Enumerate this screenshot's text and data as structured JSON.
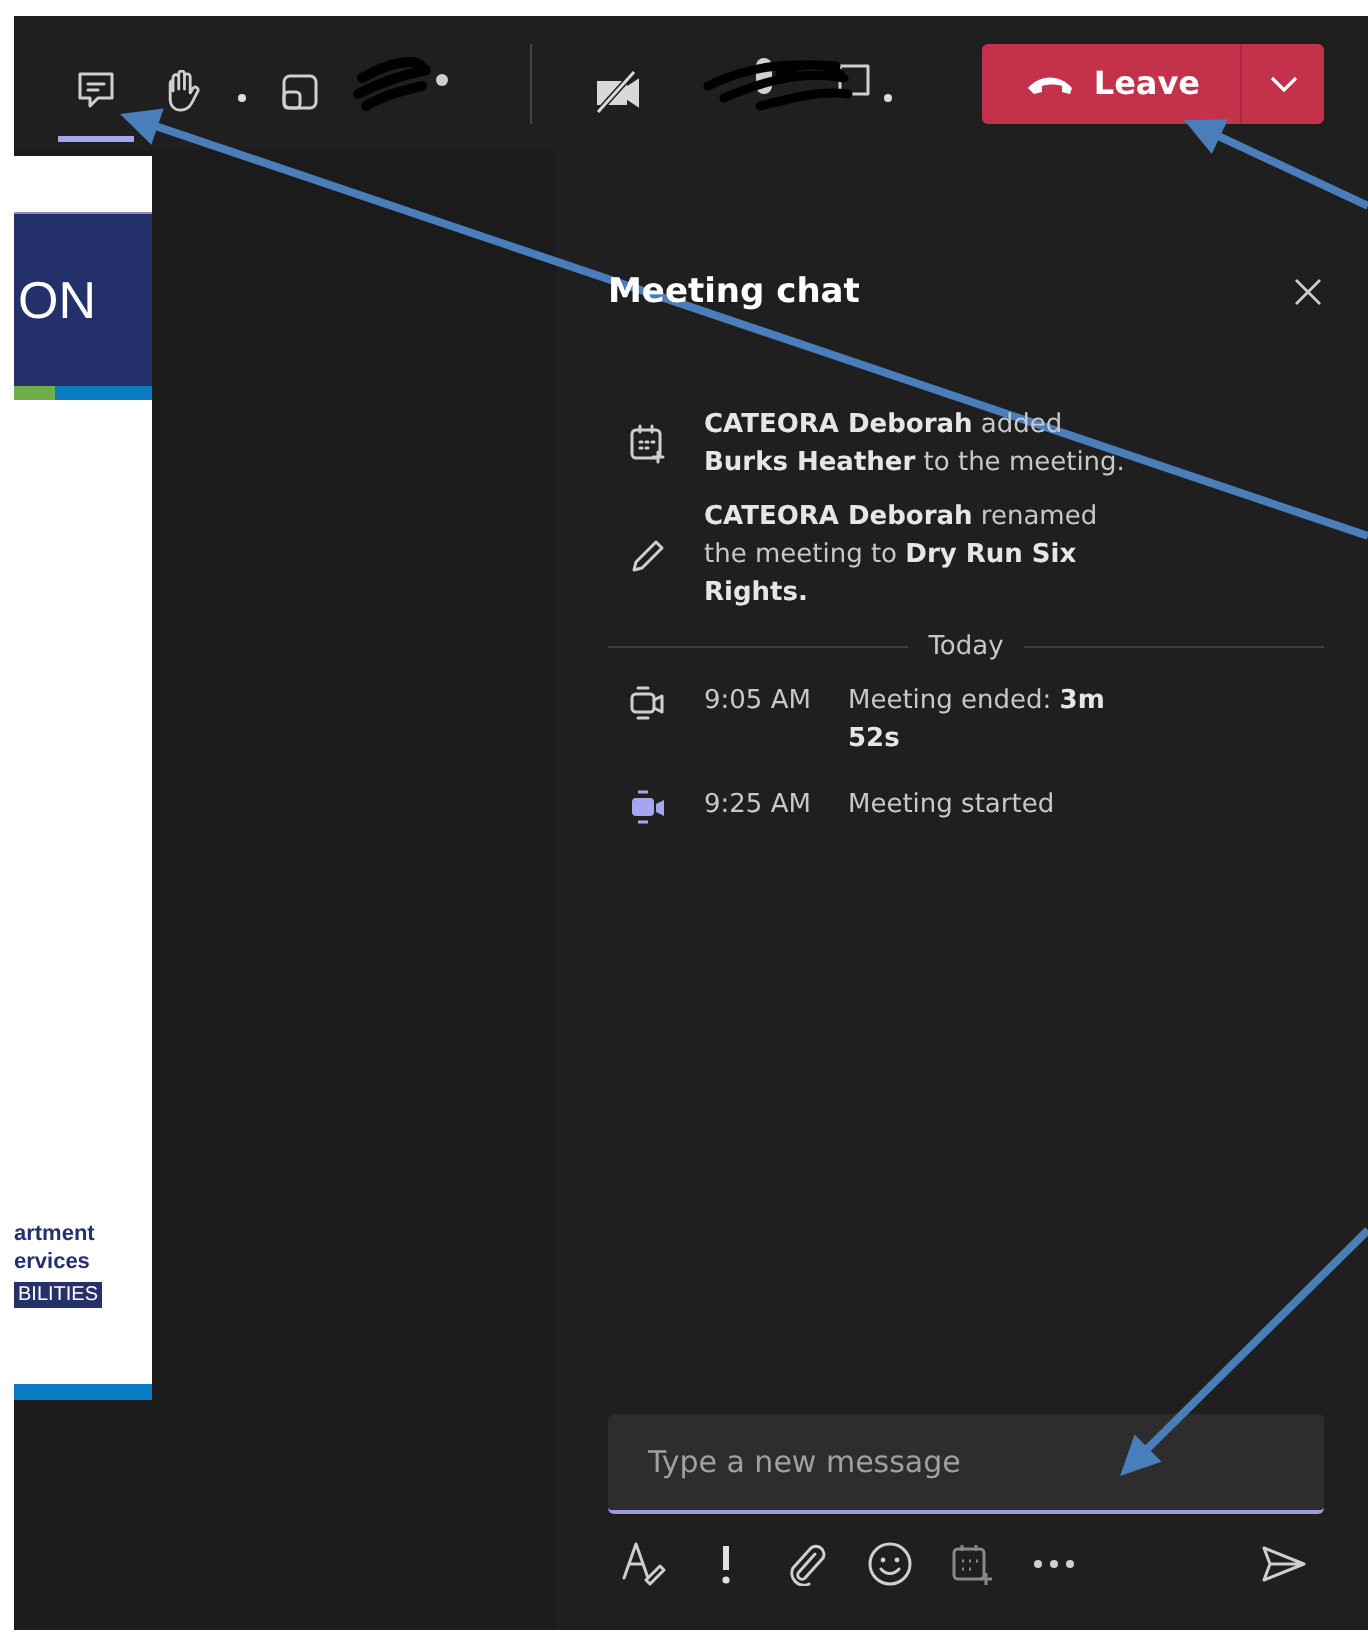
{
  "toolbar": {
    "tools": [
      {
        "kind": "chat",
        "selected": true
      },
      {
        "kind": "hand",
        "selected": false
      },
      {
        "kind": "dot"
      },
      {
        "kind": "share",
        "selected": false
      },
      {
        "kind": "scribble"
      },
      {
        "kind": "separator"
      },
      {
        "kind": "camera-off",
        "selected": false
      },
      {
        "kind": "scribble-mic"
      },
      {
        "kind": "dot"
      }
    ],
    "leave_button": {
      "label": "Leave"
    }
  },
  "shared_slide": {
    "header_text": "ON",
    "footer_lines": [
      "artment",
      "ervices"
    ],
    "badge": "BILITIES"
  },
  "meeting_chat": {
    "title": "Meeting chat",
    "events": [
      {
        "kind": "added",
        "text": "**CATEORA Deborah** added **Burks Heather** to the meeting."
      },
      {
        "kind": "renamed",
        "text": "**CATEORA Deborah** renamed the meeting to **Dry Run Six Rights.**"
      }
    ],
    "divider": "Today",
    "calls": [
      {
        "kind": "ended",
        "time": "9:05 AM",
        "text": "Meeting ended: **3m 52s**"
      },
      {
        "kind": "started",
        "time": "9:25 AM",
        "text": "Meeting started"
      }
    ],
    "composer": {
      "placeholder": "Type a new message"
    }
  }
}
